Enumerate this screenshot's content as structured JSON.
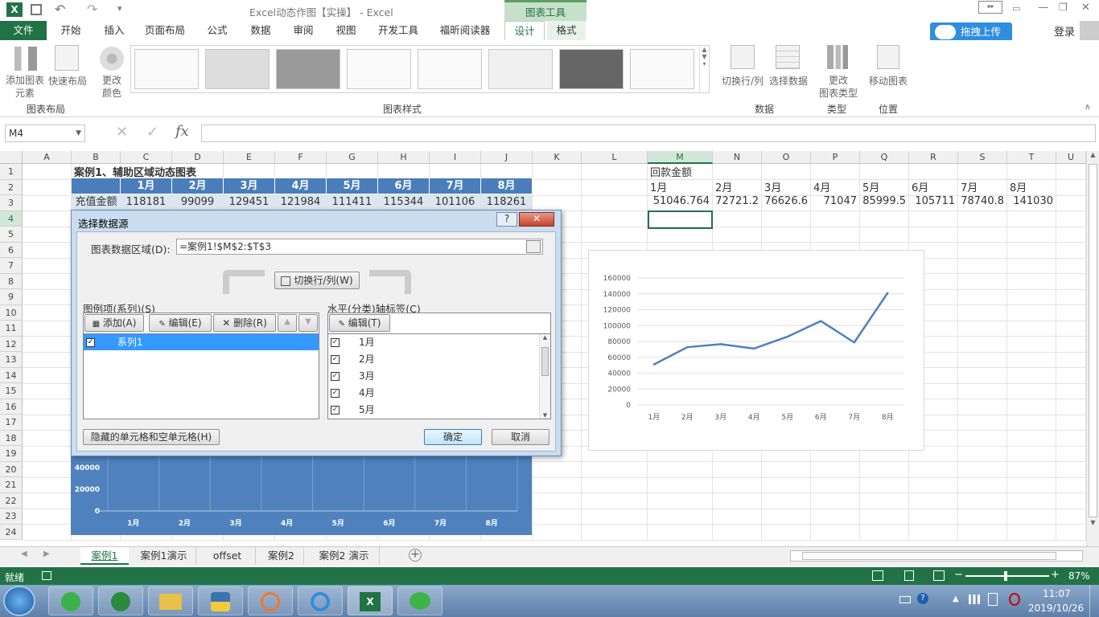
{
  "window": {
    "title": "Excel动态作图【实操】 - Excel",
    "chart_tools": "图表工具"
  },
  "ribbon_tabs": [
    "文件",
    "开始",
    "插入",
    "页面布局",
    "公式",
    "数据",
    "审阅",
    "视图",
    "开发工具",
    "福昕阅读器",
    "设计",
    "格式"
  ],
  "upload_button": "拖拽上传",
  "login": "登录",
  "ribbon": {
    "add_element": "添加图表元素",
    "add_element_l1": "添加图表",
    "add_element_l2": "元素",
    "quick_layout": "快速布局",
    "change_color_l1": "更改",
    "change_color_l2": "颜色",
    "group_layout": "图表布局",
    "group_styles": "图表样式",
    "switch_rowcol": "切换行/列",
    "select_data": "选择数据",
    "group_data": "数据",
    "change_type_l1": "更改",
    "change_type_l2": "图表类型",
    "group_type": "类型",
    "move_chart": "移动图表",
    "group_location": "位置"
  },
  "formula": {
    "namebox": "M4",
    "fx": "fx",
    "value": ""
  },
  "columns": [
    "A",
    "B",
    "C",
    "D",
    "E",
    "F",
    "G",
    "H",
    "I",
    "J",
    "K",
    "L",
    "M",
    "N",
    "O",
    "P",
    "Q",
    "R",
    "S",
    "T",
    "U"
  ],
  "rows": [
    "1",
    "2",
    "3",
    "4",
    "5",
    "6",
    "7",
    "8",
    "9",
    "10",
    "11",
    "12",
    "13",
    "14",
    "15",
    "16",
    "17",
    "18",
    "19",
    "20",
    "21",
    "22",
    "23",
    "24"
  ],
  "sheet": {
    "b1_title": "案例1、辅助区域动态图表",
    "months": [
      "1月",
      "2月",
      "3月",
      "4月",
      "5月",
      "6月",
      "7月",
      "8月"
    ],
    "row3_label": "充值金额",
    "row3_values": [
      "118181",
      "99099",
      "129451",
      "121984",
      "111411",
      "115344",
      "101106",
      "118261"
    ],
    "m1_title": "回款金额",
    "m_months": [
      "1月",
      "2月",
      "3月",
      "4月",
      "5月",
      "6月",
      "7月",
      "8月"
    ],
    "m_values": [
      "51046.764",
      "72721.2",
      "76626.6",
      "71047",
      "85999.5",
      "105711",
      "78740.8",
      "141030"
    ]
  },
  "dialog": {
    "title": "选择数据源",
    "help": "?",
    "close": "✕",
    "range_label": "图表数据区域(D):",
    "range_value": "=案例1!$M$2:$T$3",
    "switch_button": "切换行/列(W)",
    "legend_label": "图例项(系列)(S)",
    "add": "添加(A)",
    "edit": "编辑(E)",
    "delete": "删除(R)",
    "series": [
      "系列1"
    ],
    "axis_label": "水平(分类)轴标签(C)",
    "axis_edit": "编辑(T)",
    "axis_items": [
      "1月",
      "2月",
      "3月",
      "4月",
      "5月"
    ],
    "hidden_cells": "隐藏的单元格和空单元格(H)",
    "ok": "确定",
    "cancel": "取消"
  },
  "bg_chart": {
    "y_ticks": [
      "40000",
      "20000",
      "0"
    ],
    "x_ticks": [
      "1月",
      "2月",
      "3月",
      "4月",
      "5月",
      "6月",
      "7月",
      "8月"
    ]
  },
  "chart_data": {
    "type": "line",
    "categories": [
      "1月",
      "2月",
      "3月",
      "4月",
      "5月",
      "6月",
      "7月",
      "8月"
    ],
    "series": [
      {
        "values": [
          51046.764,
          72721.2,
          76626.6,
          71047,
          85999.5,
          105711,
          78740.8,
          141030
        ]
      }
    ],
    "ylim": [
      0,
      160000
    ],
    "y_ticks": [
      "160000",
      "140000",
      "120000",
      "100000",
      "80000",
      "60000",
      "40000",
      "20000",
      "0"
    ],
    "color": "#4f81bd",
    "title": "",
    "xlabel": "",
    "ylabel": ""
  },
  "sheet_tabs": [
    "案例1",
    "案例1演示",
    "offset",
    "案例2",
    "案例2 演示"
  ],
  "status": {
    "ready": "就绪",
    "zoom": "87%"
  },
  "taskbar": {
    "time": "11:07",
    "date": "2019/10/26"
  }
}
